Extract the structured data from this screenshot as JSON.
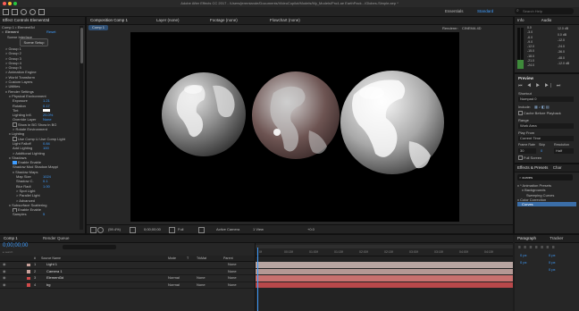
{
  "app": {
    "title": "Adobe After Effects CC 2017 - /Users/jeremiande/Documents/VideoCopilot/Models/My_Models/Pro4.ae EarthPack.../Globes-Simple.aep *"
  },
  "workspace": {
    "items": [
      "Essentials",
      "Standard"
    ],
    "search_placeholder": "Search Help"
  },
  "effect_controls": {
    "tab": "Effect Controls Element3d",
    "breadcrumb": "Comp 1 • Element3d",
    "effect_name": "Element",
    "reset": "Reset",
    "scene_interface": "Scene Interface",
    "scene_setup_button": "Scene Setup",
    "rows": [
      {
        "t": "> Group 1",
        "i": 1
      },
      {
        "t": "> Group 2",
        "i": 1
      },
      {
        "t": "> Group 3",
        "i": 1
      },
      {
        "t": "> Group 4",
        "i": 1
      },
      {
        "t": "> Group 5",
        "i": 1
      },
      {
        "t": "> Animation Engine",
        "i": 1
      },
      {
        "t": "> World Transform",
        "i": 1
      },
      {
        "t": "> Custom Layers",
        "i": 1
      },
      {
        "t": "> Utilities",
        "i": 1
      },
      {
        "t": "v Render Settings",
        "i": 1
      },
      {
        "t": "v Physical Environment",
        "i": 2
      },
      {
        "t": "Exposure",
        "v": "1.21",
        "i": 3
      },
      {
        "t": "Rotation",
        "v": "0.17",
        "i": 3
      },
      {
        "t": "Tint",
        "i": 3,
        "sw": 1
      },
      {
        "t": "Lighting Infl.",
        "v": "25.0%",
        "i": 3
      },
      {
        "t": "Override Layer",
        "v": "None",
        "i": 3
      },
      {
        "t": "Show in BG    Show in BG",
        "i": 3,
        "c": 1
      },
      {
        "t": "> Rotate Environment",
        "i": 3
      },
      {
        "t": "v Lighting",
        "i": 2
      },
      {
        "t": "Use Comp Li    Use Comp Light",
        "i": 3,
        "c": 1
      },
      {
        "t": "Light Falloff",
        "v": "0.84",
        "i": 3
      },
      {
        "t": "Add Lighting",
        "v": "100",
        "i": 3
      },
      {
        "t": "> Additional Lighting",
        "i": 3
      },
      {
        "t": "v Shadows",
        "i": 2
      },
      {
        "t": "Enable    Enable",
        "i": 3,
        "c": 1,
        "on": 1
      },
      {
        "t": "Shadow Mod    Shadow Mappi",
        "i": 3
      },
      {
        "t": "v Shadow Maps",
        "i": 3
      },
      {
        "t": "Map Size",
        "v": "1024",
        "i": 4
      },
      {
        "t": "Shadow C.",
        "v": "0.1",
        "i": 4
      },
      {
        "t": "Blur Radi",
        "v": "1.00",
        "i": 4
      },
      {
        "t": "> Spot Light",
        "i": 4
      },
      {
        "t": "> Parallel Light",
        "i": 4
      },
      {
        "t": "> Advanced",
        "i": 4
      },
      {
        "t": "v Subsurface Scattering",
        "i": 2
      },
      {
        "t": "Enable    Enable",
        "i": 3,
        "c": 1
      },
      {
        "t": "Samples",
        "v": "5",
        "i": 3
      }
    ]
  },
  "composition": {
    "tabs": [
      {
        "label": "Composition Comp 1"
      },
      {
        "label": "Layer (none)"
      },
      {
        "label": "Footage (none)"
      },
      {
        "label": "Flowchart (none)"
      }
    ],
    "comp_chip": "Comp 1",
    "renderer_label": "Renderer:",
    "renderer_value": "CINEMA 4D",
    "footer": {
      "zoom": "(59.4%)",
      "timecode": "0;00;00;00",
      "resolution": "Full",
      "camera": "Active Camera",
      "views": "1 View",
      "offset": "+0.0"
    }
  },
  "timeline": {
    "render_queue_tab": "Render Queue",
    "comp_tab": "Comp 1",
    "timecode": "0;00;00;00",
    "columns": [
      "#",
      "Source Name",
      "Mode",
      "T",
      "TrkMat",
      "Parent"
    ],
    "ruler": [
      "0f",
      "00:15f",
      "01:00f",
      "01:15f",
      "02:00f",
      "02:15f",
      "03:00f",
      "03:15f",
      "04:00f",
      "04:15f"
    ],
    "layers": [
      {
        "num": "1",
        "name": "Light 1",
        "color": "#c9a29b",
        "mode": "",
        "trk": "",
        "parent": "None",
        "bar": "#b7a4a0"
      },
      {
        "num": "2",
        "name": "Camera 1",
        "color": "#c9a29b",
        "mode": "",
        "trk": "",
        "parent": "None",
        "bar": "#b49894"
      },
      {
        "num": "3",
        "name": "Element3d",
        "color": "#d24b4b",
        "mode": "Normal",
        "trk": "None",
        "parent": "None",
        "bar": "#c8706e"
      },
      {
        "num": "4",
        "name": "bg",
        "color": "#d24b4b",
        "mode": "Normal",
        "trk": "None",
        "parent": "None",
        "bar": "#b8484a"
      }
    ]
  },
  "info_audio": {
    "tabs": [
      "Info",
      "Audio"
    ],
    "left_scale": [
      "0.0",
      "-3.0",
      "-6.0",
      "-9.0",
      "-12.0",
      "-15.0",
      "-18.0",
      "-21.0",
      "-24.0"
    ],
    "right_scale": [
      "12.0 dB",
      "0.0 dB",
      "-12.0",
      "-24.0",
      "-36.0",
      "-48.0",
      "-12.0 dB"
    ]
  },
  "preview": {
    "title": "Preview",
    "shortcut_label": "Shortcut",
    "shortcut_value": "Numpad 0",
    "include_label": "Include:",
    "cache_label": "Cache Before Playback",
    "range_label": "Range",
    "range_value": "Work Area",
    "play_from_label": "Play From",
    "play_from_value": "Current Time",
    "frame_rate_label": "Frame Rate",
    "skip_label": "Skip",
    "resolution_label": "Resolution",
    "frame_rate_value": "30",
    "skip_value": "0",
    "resolution_value": "Half",
    "full_screen_label": "Full Screen"
  },
  "effects_presets": {
    "tabs": [
      "Effects & Presets",
      "Char"
    ],
    "search_value": "curves",
    "tree": [
      {
        "t": "v * Animation Presets",
        "i": 0
      },
      {
        "t": "v Backgrounds",
        "i": 1
      },
      {
        "t": "Sweeping Curves",
        "i": 2
      },
      {
        "t": "v Color Correction",
        "i": 0
      },
      {
        "t": "Curves",
        "i": 1,
        "sel": 1
      }
    ]
  },
  "paragraph": {
    "tabs": [
      "Paragraph",
      "Tracker"
    ],
    "values": [
      "0 px",
      "0 px",
      "0 px",
      "0 px",
      "0 px"
    ]
  },
  "colors": {
    "accent": "#3f9dff",
    "panel": "#262626",
    "bg": "#1d1d1d",
    "viewer": "#000000"
  }
}
